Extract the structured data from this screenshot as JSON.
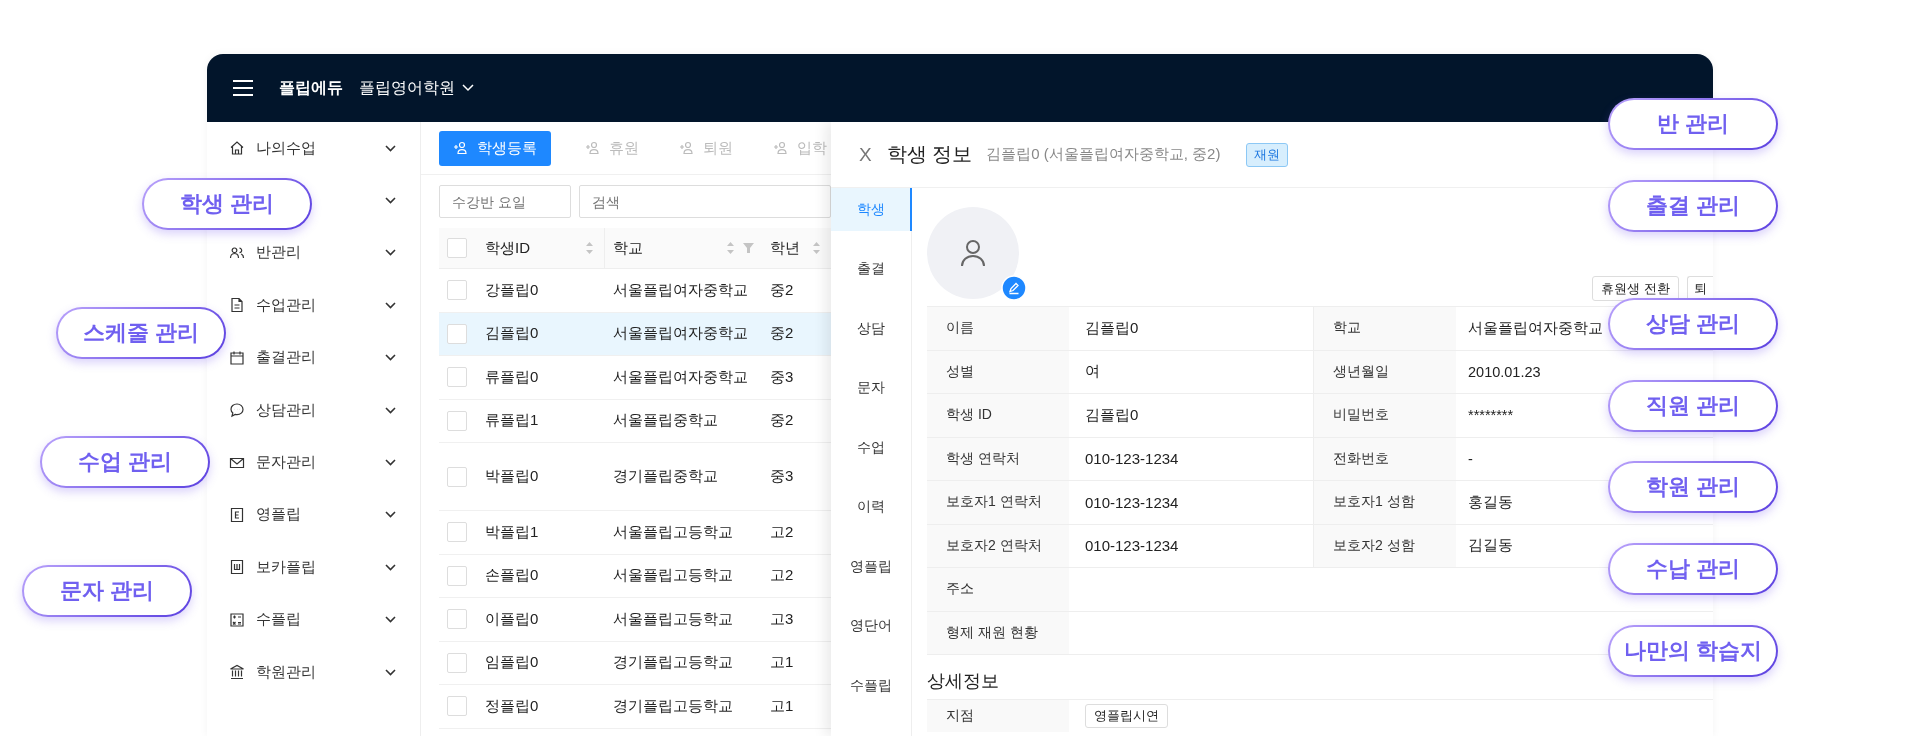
{
  "header": {
    "brand": "플립에듀",
    "academy": "플립영어학원"
  },
  "sidebar": {
    "items": [
      {
        "label": "나의수업",
        "expanded": false
      },
      {
        "expanded": false
      },
      {
        "label": "반관리",
        "expanded": false
      },
      {
        "label": "수업관리",
        "expanded": false
      },
      {
        "label": "출결관리",
        "expanded": false
      },
      {
        "label": "상담관리",
        "expanded": false
      },
      {
        "label": "문자관리",
        "expanded": false
      },
      {
        "label": "영플립",
        "expanded": false
      },
      {
        "label": "보카플립",
        "expanded": false
      },
      {
        "label": "수플립",
        "expanded": false
      },
      {
        "label": "학원관리",
        "expanded": false
      }
    ]
  },
  "toolbar": [
    {
      "label": "학생등록",
      "disabled": false
    },
    {
      "label": "휴원",
      "disabled": true
    },
    {
      "label": "퇴원",
      "disabled": true
    },
    {
      "label": "입학",
      "disabled": true
    }
  ],
  "filters": [
    {
      "placeholder": "수강반 요일"
    },
    {
      "placeholder": "검색"
    }
  ],
  "table": {
    "header_checked": false,
    "columns": [
      {
        "label": "학생ID",
        "sortable": true,
        "filter": false
      },
      {
        "label": "학교",
        "sortable": true,
        "filter": true
      },
      {
        "label": "학년",
        "sortable": true,
        "filter": false
      }
    ],
    "rows": [
      {
        "id": "강플립0",
        "school": "서울플립여자중학교",
        "grade": "중2",
        "selected": false,
        "checked": false
      },
      {
        "id": "김플립0",
        "school": "서울플립여자중학교",
        "grade": "중2",
        "selected": true,
        "checked": false
      },
      {
        "id": "류플립0",
        "school": "서울플립여자중학교",
        "grade": "중3",
        "selected": false,
        "checked": false
      },
      {
        "id": "류플립1",
        "school": "서울플립중학교",
        "grade": "중2",
        "selected": false,
        "checked": false
      },
      {
        "id": "박플립0",
        "school": "경기플립중학교",
        "grade": "중3",
        "selected": false,
        "checked": false
      },
      {
        "id": "박플립1",
        "school": "서울플립고등학교",
        "grade": "고2",
        "selected": false,
        "checked": false
      },
      {
        "id": "손플립0",
        "school": "서울플립고등학교",
        "grade": "고2",
        "selected": false,
        "checked": false
      },
      {
        "id": "이플립0",
        "school": "서울플립고등학교",
        "grade": "고3",
        "selected": false,
        "checked": false
      },
      {
        "id": "임플립0",
        "school": "경기플립고등학교",
        "grade": "고1",
        "selected": false,
        "checked": false
      },
      {
        "id": "정플립0",
        "school": "경기플립고등학교",
        "grade": "고1",
        "selected": false,
        "checked": false
      }
    ]
  },
  "panel": {
    "close": "X",
    "title": "학생 정보",
    "subtitle": "김플립0 (서울플립여자중학교, 중2)",
    "badge": "재원",
    "tabs": [
      {
        "label": "학생",
        "selected": true
      },
      {
        "label": "출결",
        "selected": false
      },
      {
        "label": "상담",
        "selected": false
      },
      {
        "label": "문자",
        "selected": false
      },
      {
        "label": "수업",
        "selected": false
      },
      {
        "label": "이력",
        "selected": false
      },
      {
        "label": "영플립",
        "selected": false
      },
      {
        "label": "영단어",
        "selected": false
      },
      {
        "label": "수플립",
        "selected": false
      }
    ],
    "actions": [
      "휴원생 전환",
      "퇴"
    ],
    "info": [
      {
        "label": "이름",
        "value": "김플립0",
        "label2": "학교",
        "value2": "서울플립여자중학교"
      },
      {
        "label": "성별",
        "value": "여",
        "label2": "생년월일",
        "value2": "2010.01.23"
      },
      {
        "label": "학생 ID",
        "value": "김플립0",
        "label2": "비밀번호",
        "value2": "********"
      },
      {
        "label": "학생 연락처",
        "value": "010-123-1234",
        "label2": "전화번호",
        "value2": "-"
      },
      {
        "label": "보호자1 연락처",
        "value": "010-123-1234",
        "label2": "보호자1 성함",
        "value2": "홍길동"
      },
      {
        "label": "보호자2 연락처",
        "value": "010-123-1234",
        "label2": "보호자2 성함",
        "value2": "김길동"
      },
      {
        "label": "주소"
      },
      {
        "label": "형제 재원 현황"
      }
    ],
    "details_title": "상세정보",
    "details": [
      {
        "label": "지점",
        "tag": "영플립시연"
      }
    ]
  },
  "callouts_left": [
    "학생 관리",
    "스케줄 관리",
    "수업 관리",
    "문자 관리"
  ],
  "callouts_right": [
    "반 관리",
    "출결 관리",
    "상담 관리",
    "직원 관리",
    "학원 관리",
    "수납 관리",
    "나만의 학습지"
  ]
}
